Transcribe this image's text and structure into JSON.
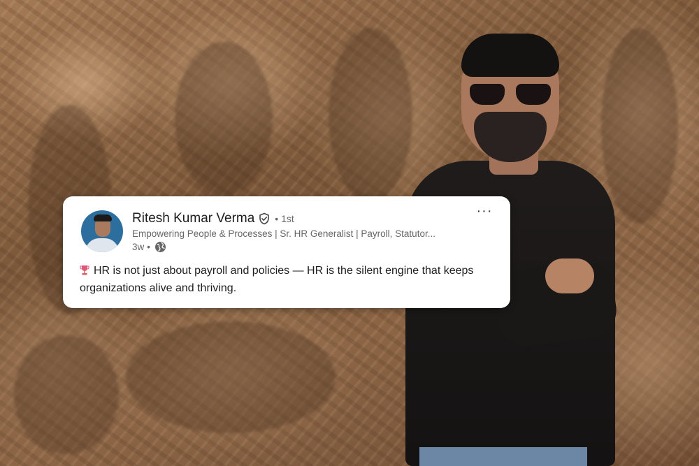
{
  "post": {
    "author_name": "Ritesh Kumar Verma",
    "connection_degree": "• 1st",
    "headline": "Empowering People & Processes | Sr. HR Generalist | Payroll, Statutor...",
    "posted_ago": "3w",
    "meta_separator": "•",
    "visibility_icon": "globe-icon",
    "verified_icon": "verified-badge-icon",
    "more_label": "···",
    "body_emoji": "trophy-icon",
    "body_text": "HR is not just about payroll and policies — HR is the silent engine that keeps organizations alive and thriving."
  },
  "colors": {
    "card_bg": "#ffffff",
    "name": "#1d1d1d",
    "secondary_text": "#666666",
    "background_bronze": "#8c6545"
  }
}
